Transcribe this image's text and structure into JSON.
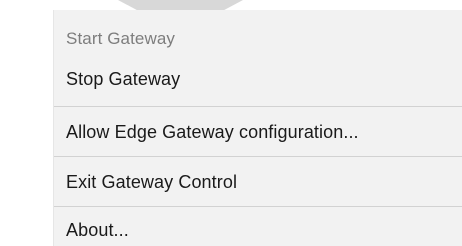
{
  "menu": {
    "items": [
      {
        "label": "Start Gateway",
        "enabled": false
      },
      {
        "label": "Stop Gateway",
        "enabled": true
      },
      {
        "label": "Allow Edge Gateway configuration...",
        "enabled": true
      },
      {
        "label": "Exit Gateway Control",
        "enabled": true
      },
      {
        "label": "About...",
        "enabled": true
      }
    ]
  },
  "colors": {
    "menu_background": "#f2f2f2",
    "separator": "#d2d2d2",
    "enabled_text": "#1a1a1a",
    "disabled_text": "#7d7d7d"
  }
}
